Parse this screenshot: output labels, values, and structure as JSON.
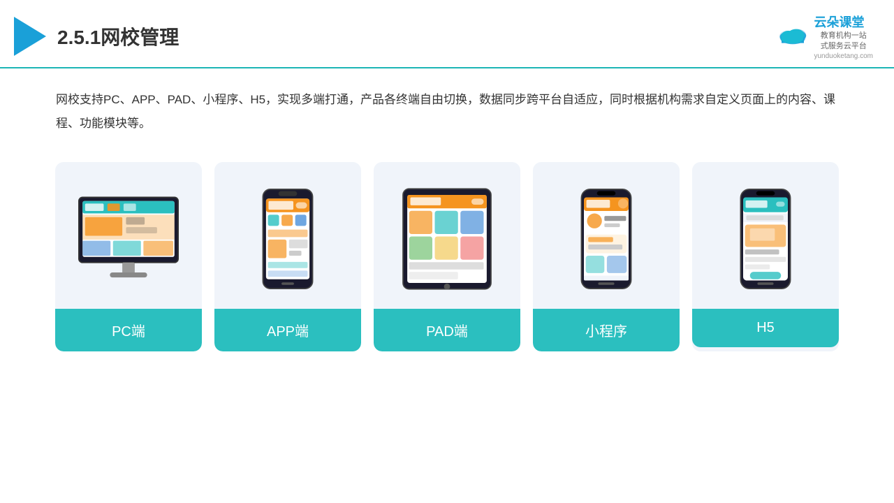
{
  "header": {
    "title": "2.5.1网校管理",
    "logo_name": "云朵课堂",
    "logo_url": "yunduoketang.com",
    "logo_tagline1": "教育机构一站",
    "logo_tagline2": "式服务云平台"
  },
  "description": {
    "text": "网校支持PC、APP、PAD、小程序、H5，实现多端打通，产品各终端自由切换，数据同步跨平台自适应，同时根据机构需求自定义页面上的内容、课程、功能模块等。"
  },
  "cards": [
    {
      "id": "pc",
      "label": "PC端",
      "device": "pc"
    },
    {
      "id": "app",
      "label": "APP端",
      "device": "phone"
    },
    {
      "id": "pad",
      "label": "PAD端",
      "device": "tablet"
    },
    {
      "id": "miniapp",
      "label": "小程序",
      "device": "phone"
    },
    {
      "id": "h5",
      "label": "H5",
      "device": "phone"
    }
  ],
  "colors": {
    "teal": "#2bbfbf",
    "blue": "#1aa0d8",
    "border_bottom": "#1cb5b5"
  }
}
